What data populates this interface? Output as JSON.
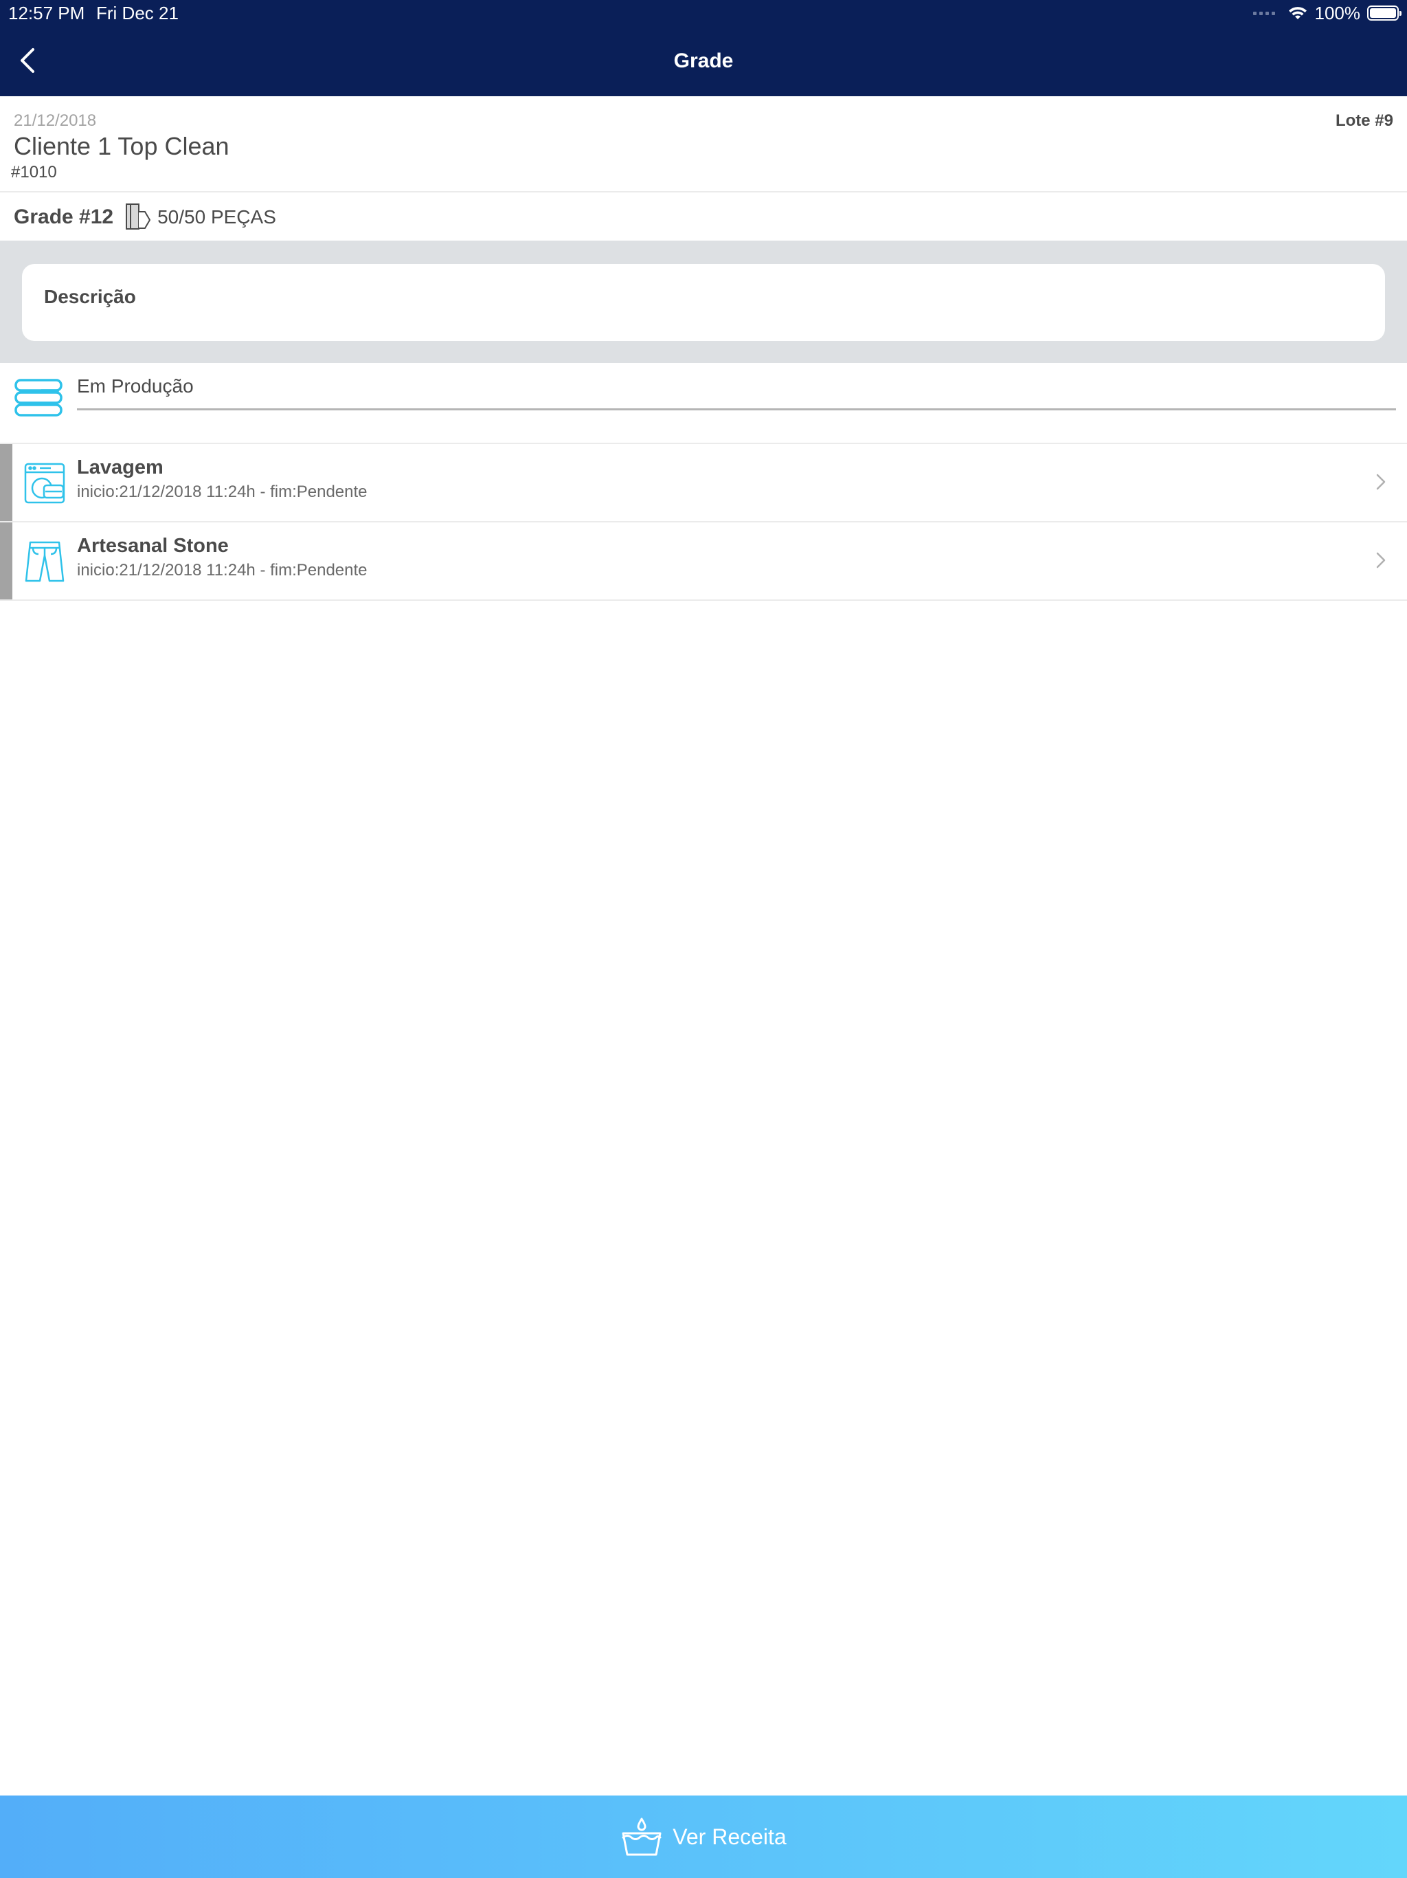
{
  "status_bar": {
    "time": "12:57 PM",
    "date": "Fri Dec 21",
    "battery": "100%"
  },
  "nav": {
    "title": "Grade",
    "back_icon": "chevron-left-icon"
  },
  "header": {
    "date": "21/12/2018",
    "client": "Cliente 1 Top Clean",
    "code": "#1010",
    "lote": "Lote #9"
  },
  "grade": {
    "label": "Grade #12",
    "pieces": "50/50 PEÇAS",
    "icon": "clothing-tag-icon"
  },
  "description": {
    "label": "Descrição"
  },
  "status": {
    "label": "Em Produção",
    "icon": "stacked-towels-icon"
  },
  "processes": [
    {
      "title": "Lavagem",
      "subtitle": "inicio:21/12/2018 11:24h - fim:Pendente",
      "icon": "washing-machine-icon"
    },
    {
      "title": "Artesanal Stone",
      "subtitle": "inicio:21/12/2018 11:24h - fim:Pendente",
      "icon": "jeans-icon"
    }
  ],
  "footer": {
    "label": "Ver Receita",
    "icon": "basin-drop-icon"
  },
  "colors": {
    "nav_background": "#0a1f58",
    "accent_icon": "#2fc2ea",
    "footer_gradient_start": "#53aef9",
    "footer_gradient_end": "#63d6fb"
  }
}
